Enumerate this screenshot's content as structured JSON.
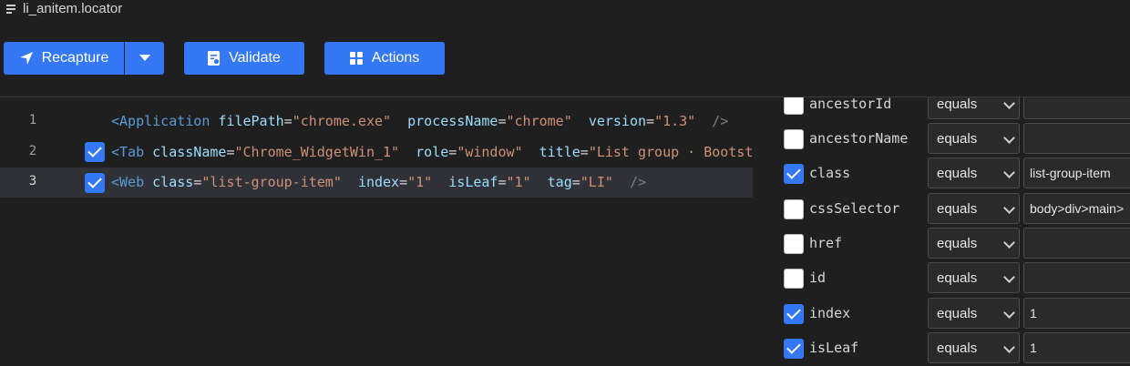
{
  "window": {
    "title": "li_anitem.locator"
  },
  "toolbar": {
    "recapture_label": "Recapture",
    "validate_label": "Validate",
    "actions_label": "Actions"
  },
  "editor": {
    "lines": [
      {
        "number": "1",
        "checked": null,
        "tag_open": "<Application",
        "attrs": [
          {
            "name": "filePath",
            "value": "\"chrome.exe\""
          },
          {
            "name": "processName",
            "value": "\"chrome\""
          },
          {
            "name": "version",
            "value": "\"1.3\""
          }
        ],
        "tag_close": "/>"
      },
      {
        "number": "2",
        "checked": true,
        "tag_open": "<Tab",
        "attrs": [
          {
            "name": "className",
            "value": "\"Chrome_WidgetWin_1\""
          },
          {
            "name": "role",
            "value": "\"window\""
          },
          {
            "name": "title",
            "value": "\"List group · Bootstr"
          }
        ],
        "tag_close": ""
      },
      {
        "number": "3",
        "checked": true,
        "tag_open": "<Web",
        "attrs": [
          {
            "name": "class",
            "value": "\"list-group-item\""
          },
          {
            "name": "index",
            "value": "\"1\""
          },
          {
            "name": "isLeaf",
            "value": "\"1\""
          },
          {
            "name": "tag",
            "value": "\"LI\""
          }
        ],
        "tag_close": "/>"
      }
    ]
  },
  "properties": [
    {
      "name": "ancestorId",
      "checked": false,
      "operator": "equals",
      "value": ""
    },
    {
      "name": "ancestorName",
      "checked": false,
      "operator": "equals",
      "value": ""
    },
    {
      "name": "class",
      "checked": true,
      "operator": "equals",
      "value": "list-group-item"
    },
    {
      "name": "cssSelector",
      "checked": false,
      "operator": "equals",
      "value": "body>div>main>"
    },
    {
      "name": "href",
      "checked": false,
      "operator": "equals",
      "value": ""
    },
    {
      "name": "id",
      "checked": false,
      "operator": "equals",
      "value": ""
    },
    {
      "name": "index",
      "checked": true,
      "operator": "equals",
      "value": "1"
    },
    {
      "name": "isLeaf",
      "checked": true,
      "operator": "equals",
      "value": "1"
    }
  ],
  "colors": {
    "accent": "#3478f6",
    "background": "#1f1f1f",
    "highlight_row": "#2f3136"
  }
}
